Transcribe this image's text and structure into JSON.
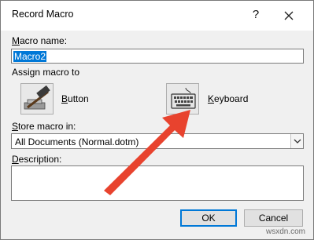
{
  "dialog": {
    "title": "Record Macro",
    "help_glyph": "?",
    "close_icon": "close-icon"
  },
  "macro_name": {
    "label_accel": "M",
    "label_rest": "acro name:",
    "value": "Macro2"
  },
  "assign": {
    "label": "Assign macro to",
    "button_accel": "B",
    "button_rest": "utton",
    "button_icon": "hammer-icon",
    "keyboard_accel": "K",
    "keyboard_rest": "eyboard",
    "keyboard_icon": "keyboard-icon"
  },
  "store": {
    "label_accel": "S",
    "label_rest": "tore macro in:",
    "selected": "All Documents (Normal.dotm)"
  },
  "description": {
    "label_accel": "D",
    "label_rest": "escription:",
    "value": ""
  },
  "buttons": {
    "ok": "OK",
    "cancel": "Cancel"
  },
  "overlay": {
    "arrow_color": "#e8432e"
  },
  "watermark": "wsxdn.com"
}
